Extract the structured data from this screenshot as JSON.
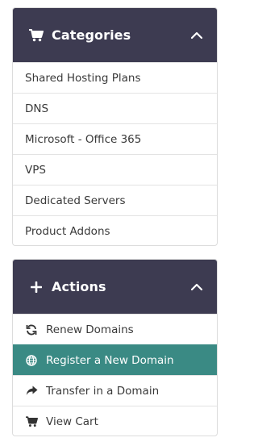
{
  "categories": {
    "title": "Categories",
    "icon": "shopping-cart-icon",
    "chevron": "chevron-up-icon",
    "items": [
      {
        "label": "Shared Hosting Plans"
      },
      {
        "label": "DNS"
      },
      {
        "label": "Microsoft - Office 365"
      },
      {
        "label": "VPS"
      },
      {
        "label": "Dedicated Servers"
      },
      {
        "label": "Product Addons"
      }
    ]
  },
  "actions": {
    "title": "Actions",
    "icon": "plus-icon",
    "chevron": "chevron-up-icon",
    "items": [
      {
        "label": "Renew Domains",
        "icon": "refresh-icon"
      },
      {
        "label": "Register a New Domain",
        "icon": "globe-icon",
        "active": true
      },
      {
        "label": "Transfer in a Domain",
        "icon": "share-arrow-icon"
      },
      {
        "label": "View Cart",
        "icon": "shopping-cart-icon"
      }
    ]
  },
  "colors": {
    "header_bg": "#3d3b51",
    "active_bg": "#3a8a84",
    "border": "#dcdcdc"
  }
}
